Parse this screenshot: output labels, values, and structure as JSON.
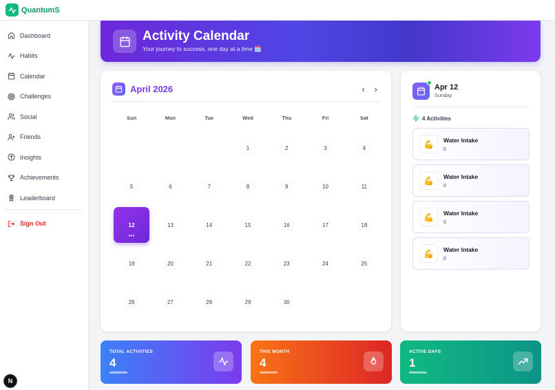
{
  "app": {
    "name": "QuantumS",
    "brand_color": "#10b981"
  },
  "sidebar": {
    "items": [
      {
        "label": "Dashboard",
        "icon": "home-icon"
      },
      {
        "label": "Habits",
        "icon": "activity-icon"
      },
      {
        "label": "Calendar",
        "icon": "calendar-icon"
      },
      {
        "label": "Challenges",
        "icon": "target-icon"
      },
      {
        "label": "Social",
        "icon": "users-icon"
      },
      {
        "label": "Friends",
        "icon": "user-plus-icon"
      },
      {
        "label": "Insights",
        "icon": "brain-icon"
      },
      {
        "label": "Achievements",
        "icon": "trophy-icon"
      },
      {
        "label": "Leaderboard",
        "icon": "award-icon"
      }
    ],
    "sign_out": "Sign Out",
    "badge": "N"
  },
  "header": {
    "title": "Activity Calendar",
    "subtitle": "Your journey to success, one day at a time 🗓️"
  },
  "calendar": {
    "month_label": "April 2026",
    "prev": "‹",
    "next": "›",
    "weekdays": [
      "Sun",
      "Mon",
      "Tue",
      "Wed",
      "Thu",
      "Fri",
      "Sat"
    ],
    "days": [
      "",
      "",
      "",
      "1",
      "2",
      "3",
      "4",
      "5",
      "6",
      "7",
      "8",
      "9",
      "10",
      "11",
      "12",
      "13",
      "14",
      "15",
      "16",
      "17",
      "18",
      "19",
      "20",
      "21",
      "22",
      "23",
      "24",
      "25",
      "26",
      "27",
      "28",
      "29",
      "30"
    ],
    "selected_day": "12",
    "selected_dots": "•••"
  },
  "day_panel": {
    "date": "Apr 12",
    "weekday": "Sunday",
    "activity_count": "4 Activities",
    "activities": [
      {
        "emoji": "💪",
        "name": "Water Intake",
        "value": "0"
      },
      {
        "emoji": "💪",
        "name": "Water Intake",
        "value": "0"
      },
      {
        "emoji": "💪",
        "name": "Water Intake",
        "value": "0"
      },
      {
        "emoji": "💪",
        "name": "Water Intake",
        "value": "0"
      }
    ]
  },
  "stats": [
    {
      "label": "TOTAL ACTIVITIES",
      "value": "4",
      "icon": "activity-icon"
    },
    {
      "label": "THIS MONTH",
      "value": "4",
      "icon": "flame-icon"
    },
    {
      "label": "ACTIVE DAYS",
      "value": "1",
      "icon": "trending-up-icon"
    }
  ]
}
